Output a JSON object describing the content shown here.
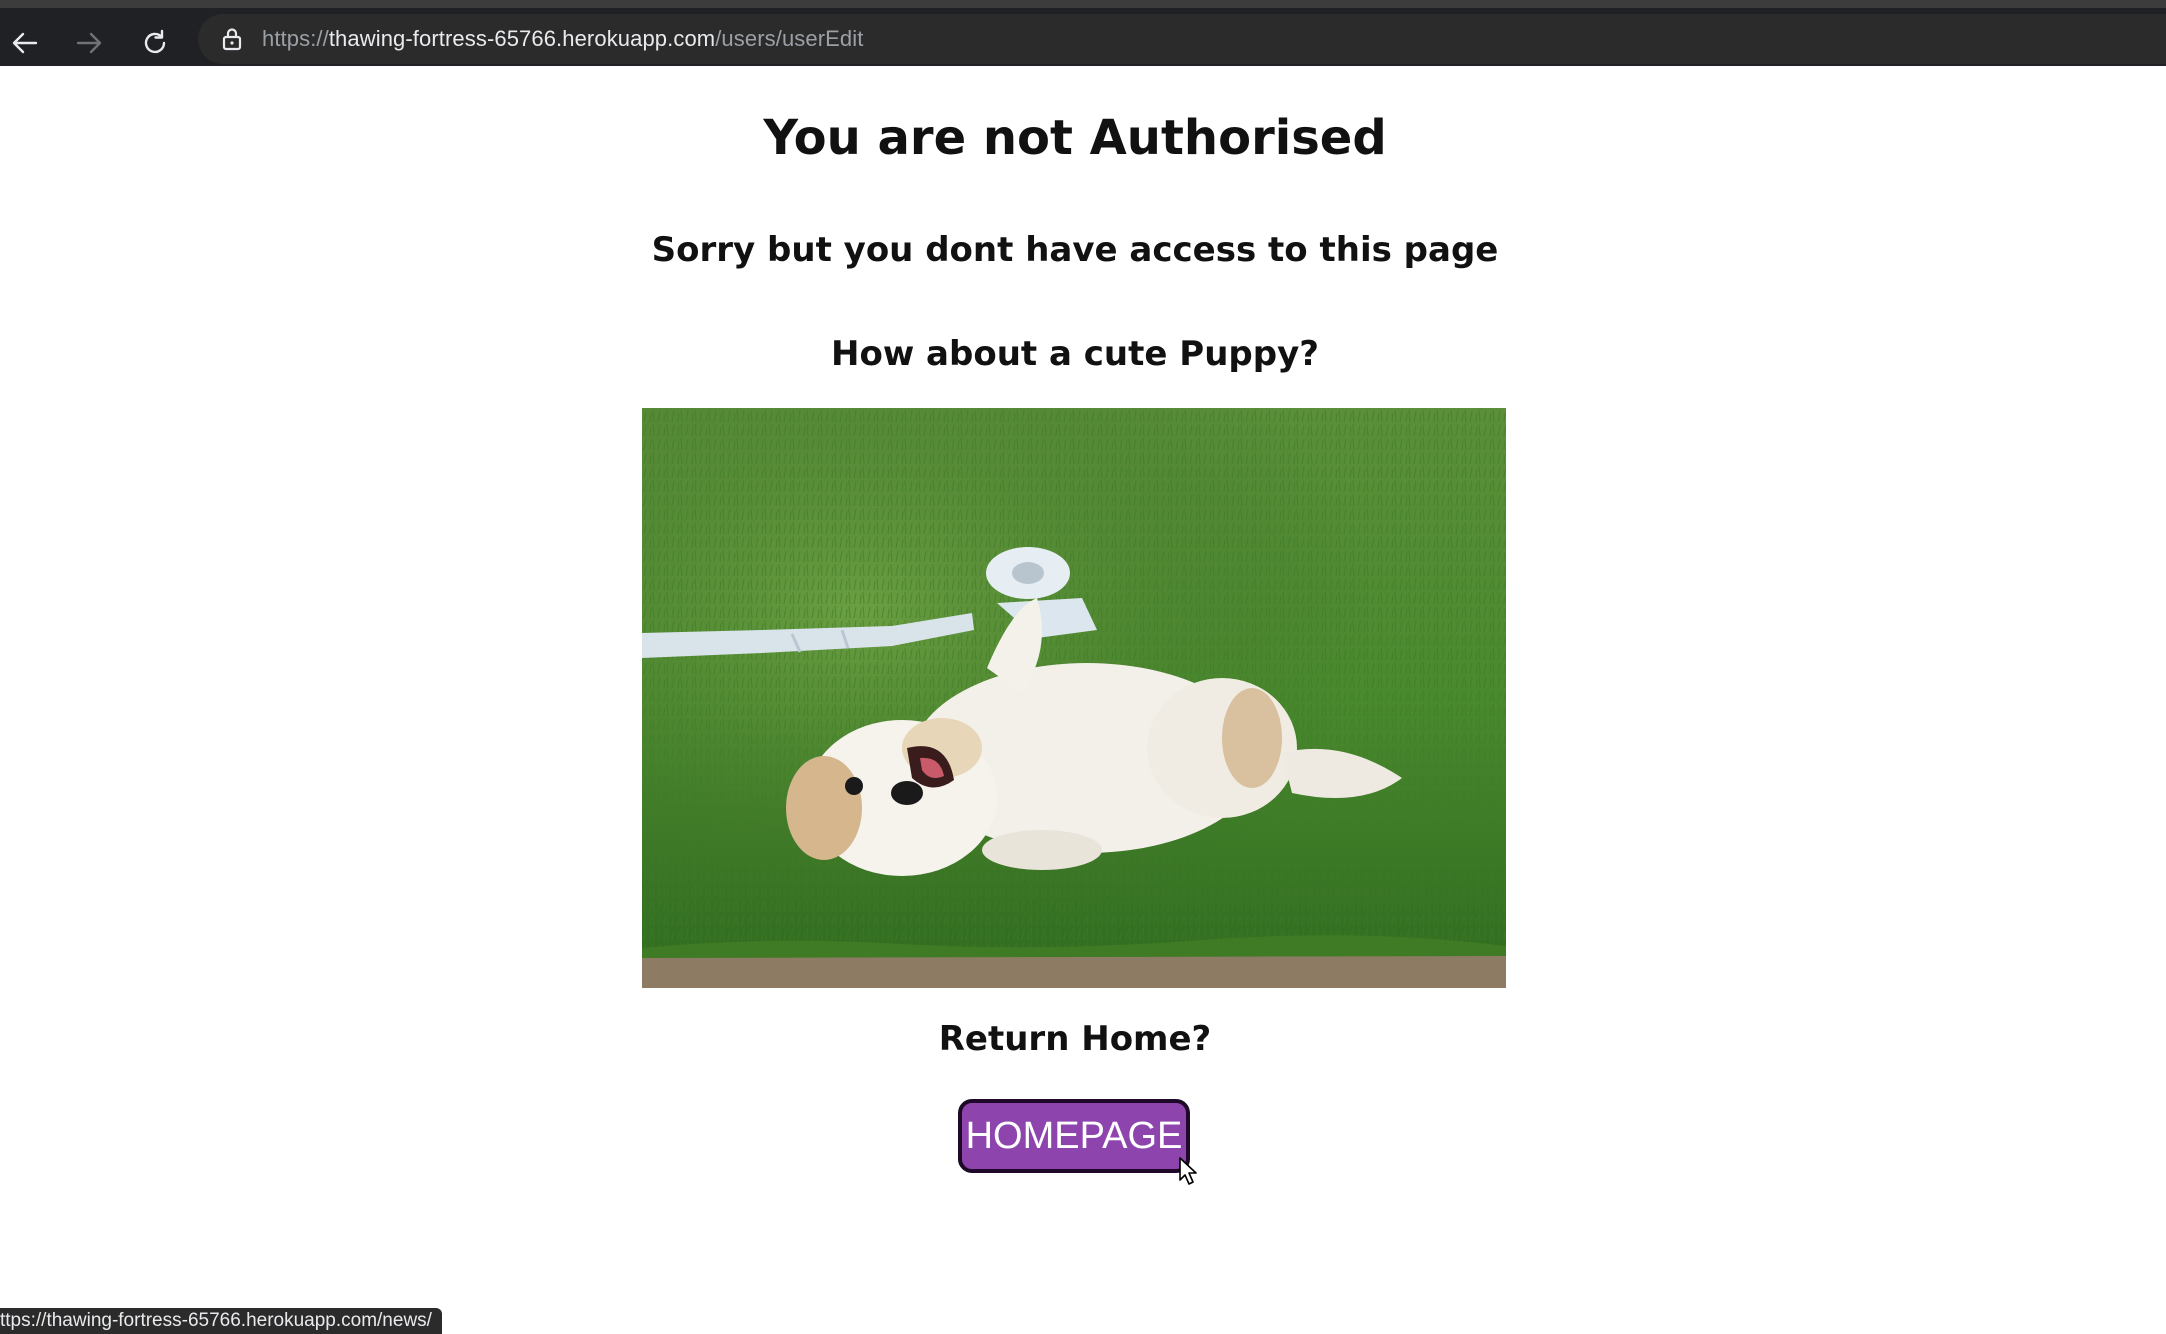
{
  "browser": {
    "back_icon": "arrow-left-icon",
    "forward_icon": "arrow-right-icon",
    "reload_icon": "reload-icon",
    "lock_icon": "lock-icon",
    "url_scheme": "https://",
    "url_host": "thawing-fortress-65766.herokuapp.com",
    "url_path": "/users/userEdit"
  },
  "page": {
    "title": "You are not Authorised",
    "subtitle": "Sorry but you dont have access to this page",
    "puppy_prompt": "How about a cute Puppy?",
    "return_prompt": "Return Home?",
    "home_button_label": "HOMEPAGE"
  },
  "status_bar": {
    "link": "ttps://thawing-fortress-65766.herokuapp.com/news/"
  },
  "colors": {
    "button_bg": "#8e44ad",
    "chrome_bg": "#202124"
  }
}
